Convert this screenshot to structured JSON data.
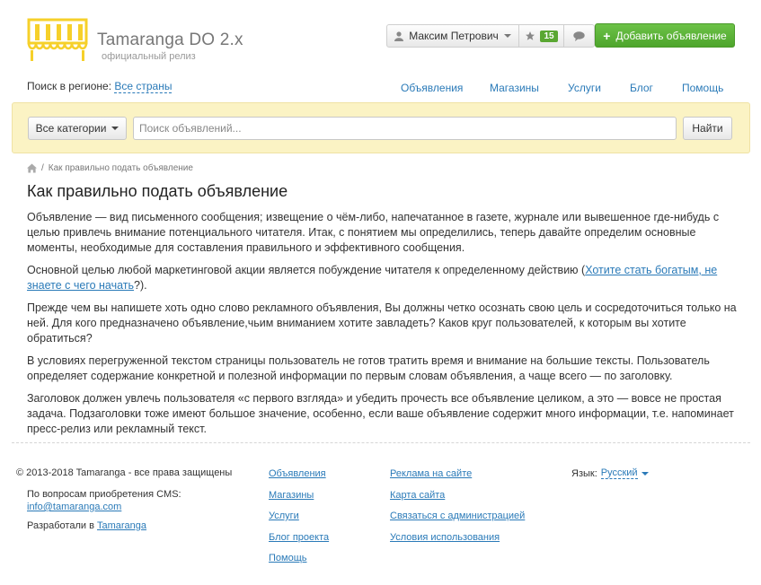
{
  "brand": {
    "title": "Tamaranga DO 2.x",
    "subtitle": "официальный релиз",
    "logo_icon": "awning-logo-icon",
    "logo_color": "#f6d02a"
  },
  "header": {
    "user_name": "Максим Петрович",
    "favorites_count": "15",
    "add_listing": "Добавить объявление"
  },
  "region": {
    "label": "Поиск в регионе:",
    "value": "Все страны"
  },
  "nav": [
    "Объявления",
    "Магазины",
    "Услуги",
    "Блог",
    "Помощь"
  ],
  "search": {
    "category": "Все категории",
    "placeholder": "Поиск объявлений...",
    "button": "Найти"
  },
  "breadcrumb": {
    "current": "Как правильно подать объявление"
  },
  "article": {
    "title": "Как правильно подать объявление",
    "p1": "Объявление — вид письменного сообщения; извещение о чём-либо, напечатанное в газете, журнале или вывешенное где-нибудь с целью привлечь внимание потенциального читателя. Итак, с понятием   мы определились, теперь давайте определим основные моменты, необходимые для составления правильного  и эффективного сообщения.",
    "p2_before": "Основной целью любой маркетинговой акции является побуждение читателя к определенному действию (",
    "p2_link": "Хотите стать богатым, не знаете с чего начать",
    "p2_after": "?).",
    "p3": "Прежде чем вы напишете хоть одно слово рекламного объявления, Вы должны четко осознать свою цель и сосредоточиться только на ней. Для кого предназначено объявление,чьим вниманием хотите завладеть? Каков круг пользователей, к которым вы хотите обратиться?",
    "p4": "В условиях перегруженной текстом страницы пользователь не готов тратить время и внимание на большие тексты. Пользователь определяет содержание конкретной и полезной информации по первым словам объявления, а чаще всего — по заголовку.",
    "p5": "Заголовок должен увлечь пользователя «с первого взгляда» и убедить прочесть все объявление целиком, а это — вовсе не простая задача. Подзаголовки тоже имеют большое значение, особенно, если ваше объявление содержит много информации, т.е. напоминает пресс-релиз или рекламный текст."
  },
  "footer": {
    "copyright": "© 2013-2018 Tamaranga - все права защищены",
    "cms_label": "По вопросам приобретения CMS:",
    "cms_email": "info@tamaranga.com",
    "dev_label": "Разработали в",
    "dev_link": "Tamaranga",
    "col1": [
      "Объявления",
      "Магазины",
      "Услуги",
      "Блог проекта",
      "Помощь"
    ],
    "col2": [
      "Реклама на сайте",
      "Карта сайта",
      "Связаться с администрацией",
      "Условия использования"
    ],
    "lang_label": "Язык:",
    "lang_value": "Русский"
  }
}
